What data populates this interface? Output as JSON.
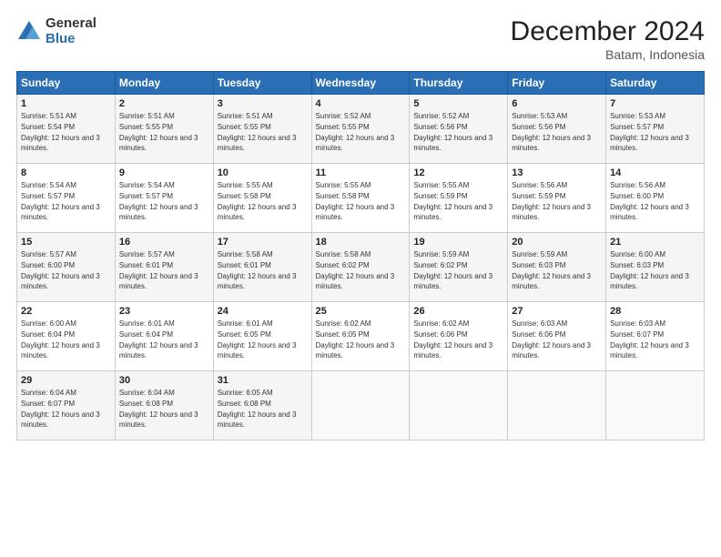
{
  "logo": {
    "general": "General",
    "blue": "Blue"
  },
  "title": "December 2024",
  "subtitle": "Batam, Indonesia",
  "days_header": [
    "Sunday",
    "Monday",
    "Tuesday",
    "Wednesday",
    "Thursday",
    "Friday",
    "Saturday"
  ],
  "weeks": [
    [
      {
        "day": "1",
        "sunrise": "5:51 AM",
        "sunset": "5:54 PM",
        "daylight": "12 hours and 3 minutes."
      },
      {
        "day": "2",
        "sunrise": "5:51 AM",
        "sunset": "5:55 PM",
        "daylight": "12 hours and 3 minutes."
      },
      {
        "day": "3",
        "sunrise": "5:51 AM",
        "sunset": "5:55 PM",
        "daylight": "12 hours and 3 minutes."
      },
      {
        "day": "4",
        "sunrise": "5:52 AM",
        "sunset": "5:55 PM",
        "daylight": "12 hours and 3 minutes."
      },
      {
        "day": "5",
        "sunrise": "5:52 AM",
        "sunset": "5:56 PM",
        "daylight": "12 hours and 3 minutes."
      },
      {
        "day": "6",
        "sunrise": "5:53 AM",
        "sunset": "5:56 PM",
        "daylight": "12 hours and 3 minutes."
      },
      {
        "day": "7",
        "sunrise": "5:53 AM",
        "sunset": "5:57 PM",
        "daylight": "12 hours and 3 minutes."
      }
    ],
    [
      {
        "day": "8",
        "sunrise": "5:54 AM",
        "sunset": "5:57 PM",
        "daylight": "12 hours and 3 minutes."
      },
      {
        "day": "9",
        "sunrise": "5:54 AM",
        "sunset": "5:57 PM",
        "daylight": "12 hours and 3 minutes."
      },
      {
        "day": "10",
        "sunrise": "5:55 AM",
        "sunset": "5:58 PM",
        "daylight": "12 hours and 3 minutes."
      },
      {
        "day": "11",
        "sunrise": "5:55 AM",
        "sunset": "5:58 PM",
        "daylight": "12 hours and 3 minutes."
      },
      {
        "day": "12",
        "sunrise": "5:55 AM",
        "sunset": "5:59 PM",
        "daylight": "12 hours and 3 minutes."
      },
      {
        "day": "13",
        "sunrise": "5:56 AM",
        "sunset": "5:59 PM",
        "daylight": "12 hours and 3 minutes."
      },
      {
        "day": "14",
        "sunrise": "5:56 AM",
        "sunset": "6:00 PM",
        "daylight": "12 hours and 3 minutes."
      }
    ],
    [
      {
        "day": "15",
        "sunrise": "5:57 AM",
        "sunset": "6:00 PM",
        "daylight": "12 hours and 3 minutes."
      },
      {
        "day": "16",
        "sunrise": "5:57 AM",
        "sunset": "6:01 PM",
        "daylight": "12 hours and 3 minutes."
      },
      {
        "day": "17",
        "sunrise": "5:58 AM",
        "sunset": "6:01 PM",
        "daylight": "12 hours and 3 minutes."
      },
      {
        "day": "18",
        "sunrise": "5:58 AM",
        "sunset": "6:02 PM",
        "daylight": "12 hours and 3 minutes."
      },
      {
        "day": "19",
        "sunrise": "5:59 AM",
        "sunset": "6:02 PM",
        "daylight": "12 hours and 3 minutes."
      },
      {
        "day": "20",
        "sunrise": "5:59 AM",
        "sunset": "6:03 PM",
        "daylight": "12 hours and 3 minutes."
      },
      {
        "day": "21",
        "sunrise": "6:00 AM",
        "sunset": "6:03 PM",
        "daylight": "12 hours and 3 minutes."
      }
    ],
    [
      {
        "day": "22",
        "sunrise": "6:00 AM",
        "sunset": "6:04 PM",
        "daylight": "12 hours and 3 minutes."
      },
      {
        "day": "23",
        "sunrise": "6:01 AM",
        "sunset": "6:04 PM",
        "daylight": "12 hours and 3 minutes."
      },
      {
        "day": "24",
        "sunrise": "6:01 AM",
        "sunset": "6:05 PM",
        "daylight": "12 hours and 3 minutes."
      },
      {
        "day": "25",
        "sunrise": "6:02 AM",
        "sunset": "6:05 PM",
        "daylight": "12 hours and 3 minutes."
      },
      {
        "day": "26",
        "sunrise": "6:02 AM",
        "sunset": "6:06 PM",
        "daylight": "12 hours and 3 minutes."
      },
      {
        "day": "27",
        "sunrise": "6:03 AM",
        "sunset": "6:06 PM",
        "daylight": "12 hours and 3 minutes."
      },
      {
        "day": "28",
        "sunrise": "6:03 AM",
        "sunset": "6:07 PM",
        "daylight": "12 hours and 3 minutes."
      }
    ],
    [
      {
        "day": "29",
        "sunrise": "6:04 AM",
        "sunset": "6:07 PM",
        "daylight": "12 hours and 3 minutes."
      },
      {
        "day": "30",
        "sunrise": "6:04 AM",
        "sunset": "6:08 PM",
        "daylight": "12 hours and 3 minutes."
      },
      {
        "day": "31",
        "sunrise": "6:05 AM",
        "sunset": "6:08 PM",
        "daylight": "12 hours and 3 minutes."
      },
      null,
      null,
      null,
      null
    ]
  ]
}
